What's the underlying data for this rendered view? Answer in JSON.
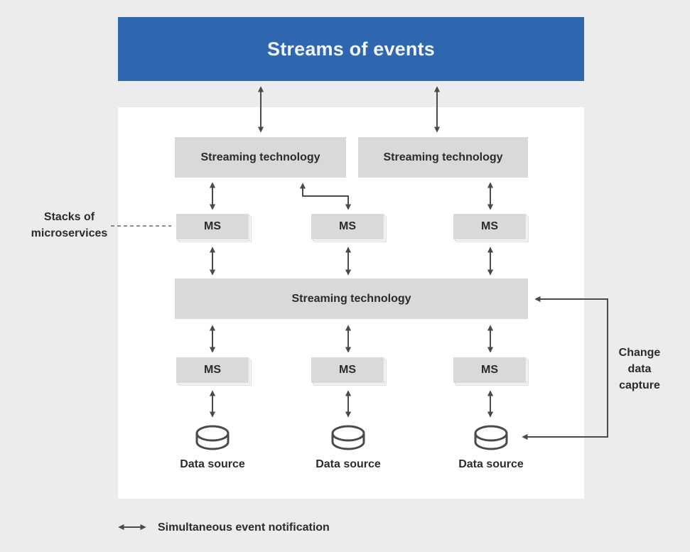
{
  "header": {
    "title": "Streams of events"
  },
  "streaming": {
    "top_left": "Streaming technology",
    "top_right": "Streaming technology",
    "middle": "Streaming technology"
  },
  "microservices": {
    "row1": [
      "MS",
      "MS",
      "MS"
    ],
    "row2": [
      "MS",
      "MS",
      "MS"
    ]
  },
  "data_sources": [
    "Data source",
    "Data source",
    "Data source"
  ],
  "annotations": {
    "stacks_line1": "Stacks of",
    "stacks_line2": "microservices",
    "cdc_line1": "Change",
    "cdc_line2": "data",
    "cdc_line3": "capture"
  },
  "legend": {
    "icon": "double-arrow-icon",
    "label": "Simultaneous event notification"
  },
  "colors": {
    "banner": "#2e66b0",
    "box": "#d9d9d9",
    "arrow": "#4a4a4a",
    "background": "#ececee",
    "panel": "#ffffff"
  }
}
